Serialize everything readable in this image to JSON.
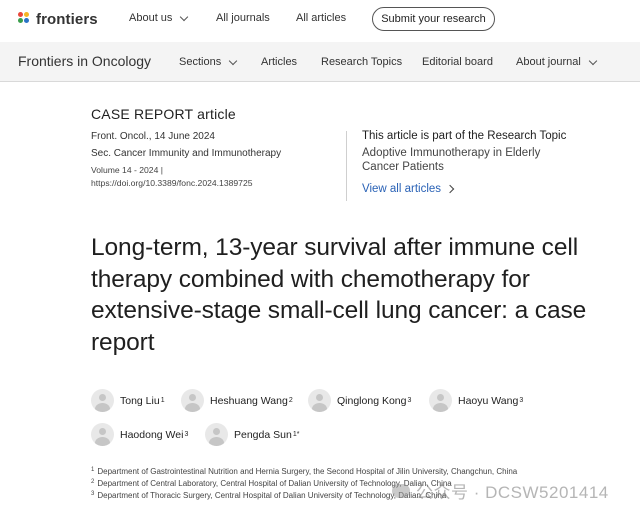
{
  "topnav": {
    "logo_text": "frontiers",
    "about_us": "About us",
    "all_journals": "All journals",
    "all_articles": "All articles",
    "submit": "Submit your research"
  },
  "journalnav": {
    "journal_name": "Frontiers in Oncology",
    "items": [
      "Sections",
      "Articles",
      "Research Topics",
      "Editorial board",
      "About journal"
    ]
  },
  "article": {
    "type": "CASE REPORT article",
    "journal_date": "Front. Oncol., 14 June 2024",
    "section": "Sec. Cancer Immunity and Immunotherapy",
    "volume": "Volume 14 - 2024 |",
    "doi": "https://doi.org/10.3389/fonc.2024.1389725",
    "research_topic_label": "This article is part of the Research Topic",
    "research_topic_title": "Adoptive Immunotherapy in Elderly Cancer Patients",
    "view_all": "View all articles",
    "title": "Long-term, 13-year survival after immune cell therapy combined with chemotherapy for extensive-stage small-cell lung cancer: a case report"
  },
  "authors": [
    {
      "name": "Tong Liu",
      "sup": "1"
    },
    {
      "name": "Heshuang Wang",
      "sup": "2"
    },
    {
      "name": "Qinglong Kong",
      "sup": "3"
    },
    {
      "name": "Haoyu Wang",
      "sup": "3"
    },
    {
      "name": "Haodong Wei",
      "sup": "3"
    },
    {
      "name": "Pengda Sun",
      "sup": "1*"
    }
  ],
  "affiliations": [
    {
      "num": "1",
      "text": "Department of Gastrointestinal Nutrition and Hernia Surgery, the Second Hospital of Jilin University, Changchun, China"
    },
    {
      "num": "2",
      "text": "Department of Central Laboratory, Central Hospital of Dalian University of Technology, Dalian, China"
    },
    {
      "num": "3",
      "text": "Department of Thoracic Surgery, Central Hospital of Dalian University of Technology, Dalian, China"
    }
  ],
  "watermark": "公众号 · DCSW5201414",
  "colors": {
    "link": "#2a62b6",
    "nav_bg": "#f4f4f4",
    "logo_dots": [
      "#e8473b",
      "#f5b625",
      "#3a9e4b",
      "#2a73c6"
    ]
  }
}
